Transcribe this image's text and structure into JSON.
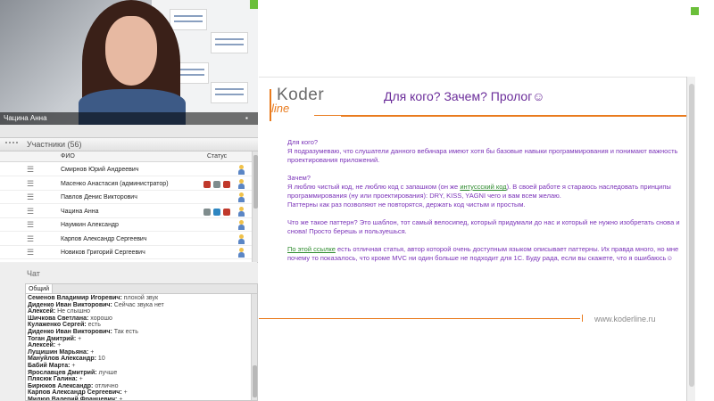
{
  "video": {
    "presenter_name": "Чацина Анна"
  },
  "participants": {
    "title": "Участники (56)",
    "columns": {
      "name": "ФИО",
      "status": "Статус"
    },
    "rows": [
      {
        "name": "Смирнов Юрий Андреевич",
        "icons": []
      },
      {
        "name": "Масенко Анастасия  (администратор)",
        "icons": [
          "#c0392b",
          "#7f8c8d",
          "#c0392b"
        ]
      },
      {
        "name": "Павлов Денис Викторович",
        "icons": []
      },
      {
        "name": "Чацина Анна",
        "icons": [
          "#7f8c8d",
          "#2e86c1",
          "#c0392b"
        ]
      },
      {
        "name": "Наумкин Александр",
        "icons": []
      },
      {
        "name": "Карпов Александр Сергеевич",
        "icons": []
      },
      {
        "name": "Новиков Григорий Сергеевич",
        "icons": []
      }
    ]
  },
  "chat": {
    "title": "Чат",
    "tab": "Общий",
    "messages": [
      {
        "author": "Семенов Владимир Игоревич:",
        "text": " плохой звук"
      },
      {
        "author": "Диденко Иван Викторович:",
        "text": " Сейчас звука нет"
      },
      {
        "author": "Алексей:",
        "text": " Не слышно"
      },
      {
        "author": "Шичкова Светлана:",
        "text": " хорошо"
      },
      {
        "author": "Кулаженко Сергей:",
        "text": " есть"
      },
      {
        "author": "Диденко Иван Викторович:",
        "text": " Так есть"
      },
      {
        "author": "Тоган Дмитрий:",
        "text": " +"
      },
      {
        "author": "Алексей:",
        "text": " +"
      },
      {
        "author": "Лущишин Марьяна:",
        "text": " +"
      },
      {
        "author": "Мануйлов Александр:",
        "text": " 10"
      },
      {
        "author": "Бабий Марта:",
        "text": " +"
      },
      {
        "author": "Ярославцев Дмитрий:",
        "text": " лучше"
      },
      {
        "author": "Плясюк Галина:",
        "text": " +"
      },
      {
        "author": "Бирюков Александр:",
        "text": " отлично"
      },
      {
        "author": "Карпов Александр Сергеевич:",
        "text": " +"
      },
      {
        "author": "Милюр Валерий Францевич:",
        "text": " +"
      }
    ]
  },
  "slide": {
    "logo_top": "Koder",
    "logo_bottom": "line",
    "title": "Для кого? Зачем? Пролог☺",
    "q1": "Для кого?",
    "a1": "Я подразумеваю, что слушатели данного вебинара имеют хотя бы базовые навыки программирования и понимают важность проектирования приложений.",
    "q2": "Зачем?",
    "a2_part1": "Я люблю чистый код, не люблю код с запашком (он же ",
    "a2_link": "интуссский код",
    "a2_part2": "). В своей работе я стараюсь наследовать принципы программирования (ну или проектирования): DRY, KISS, YAGNI  чего и вам всем желаю.",
    "a2_line2": "Паттерны как раз позволяют не повторятся, держать код чистым и простым.",
    "p3": "Что же такое паттерн? Это шаблон, тот самый велосипед, который придумали до нас и который не нужно изобретать снова и снова! Просто берешь и пользуешься.",
    "p4_link": "По этой ссылке",
    "p4_rest": " есть отличная статья, автор которой очень доступным языком описывает паттерны. Их правда много, но мне почему то показалось, что кроме MVC ни один больше не подходит для 1С. Буду рада, если вы скажете, что я ошибаюсь☺",
    "footer_url": "www.koderline.ru"
  }
}
